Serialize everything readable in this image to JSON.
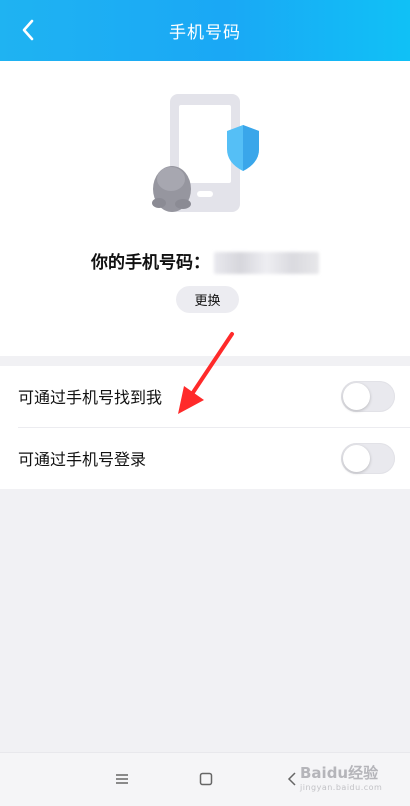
{
  "header": {
    "title": "手机号码"
  },
  "phone": {
    "label": "你的手机号码："
  },
  "change_button": "更换",
  "settings": [
    {
      "label": "可通过手机号找到我",
      "enabled": false
    },
    {
      "label": "可通过手机号登录",
      "enabled": false
    }
  ],
  "watermark": {
    "brand": "Baidu经验",
    "url": "jingyan.baidu.com"
  },
  "colors": {
    "header_start": "#1fb3f2",
    "header_end": "#10c1f6",
    "arrow": "#ff2a2a"
  },
  "icons": [
    "back-arrow-icon",
    "phone-illustration",
    "menu-icon",
    "home-icon",
    "back-icon"
  ]
}
